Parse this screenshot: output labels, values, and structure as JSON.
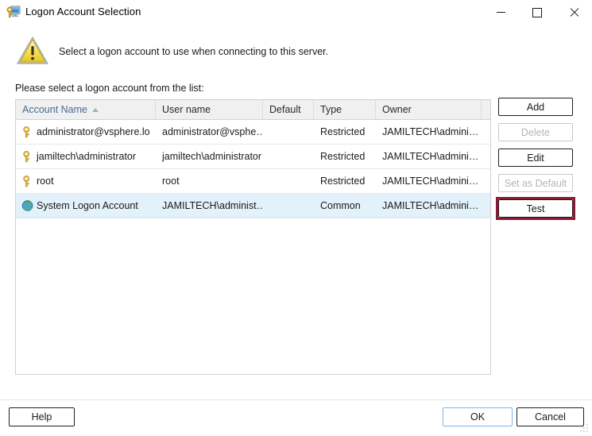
{
  "window": {
    "title": "Logon Account Selection",
    "icon": "key-monitor-icon",
    "controls": {
      "minimize": "Minimize",
      "maximize": "Maximize",
      "close": "Close"
    }
  },
  "banner": {
    "icon": "warning-triangle-icon",
    "message": "Select a logon account to use when connecting to this server."
  },
  "prompt": "Please select a logon account from the list:",
  "list": {
    "sort_column": "Account Name",
    "sort_direction": "ascending",
    "columns": [
      {
        "label": "Account Name",
        "sorted": true
      },
      {
        "label": "User name",
        "sorted": false
      },
      {
        "label": "Default",
        "sorted": false
      },
      {
        "label": "Type",
        "sorted": false
      },
      {
        "label": "Owner",
        "sorted": false
      },
      {
        "label": "",
        "sorted": false
      }
    ],
    "rows": [
      {
        "icon": "key-icon",
        "account_name": "administrator@vsphere.lo",
        "user_name": "administrator@vsphe…",
        "default": "",
        "type": "Restricted",
        "owner": "JAMILTECH\\admini…",
        "selected": false
      },
      {
        "icon": "key-icon",
        "account_name": "jamiltech\\administrator",
        "user_name": "jamiltech\\administrator",
        "default": "",
        "type": "Restricted",
        "owner": "JAMILTECH\\admini…",
        "selected": false
      },
      {
        "icon": "key-icon",
        "account_name": "root",
        "user_name": "root",
        "default": "",
        "type": "Restricted",
        "owner": "JAMILTECH\\admini…",
        "selected": false
      },
      {
        "icon": "globe-icon",
        "account_name": "System Logon Account",
        "user_name": "JAMILTECH\\administ…",
        "default": "",
        "type": "Common",
        "owner": "JAMILTECH\\admini…",
        "selected": true
      }
    ]
  },
  "side_buttons": {
    "add": "Add",
    "delete": "Delete",
    "edit": "Edit",
    "set_as_default": "Set as Default",
    "test": "Test"
  },
  "footer": {
    "help": "Help",
    "ok": "OK",
    "cancel": "Cancel"
  },
  "colors": {
    "annotation": "#8b1a33",
    "default_button_border": "#7eb4ea",
    "selection": "#e3f1fb",
    "header_background": "#f0f0f0",
    "sorted_header_text": "#4a6c8f"
  }
}
